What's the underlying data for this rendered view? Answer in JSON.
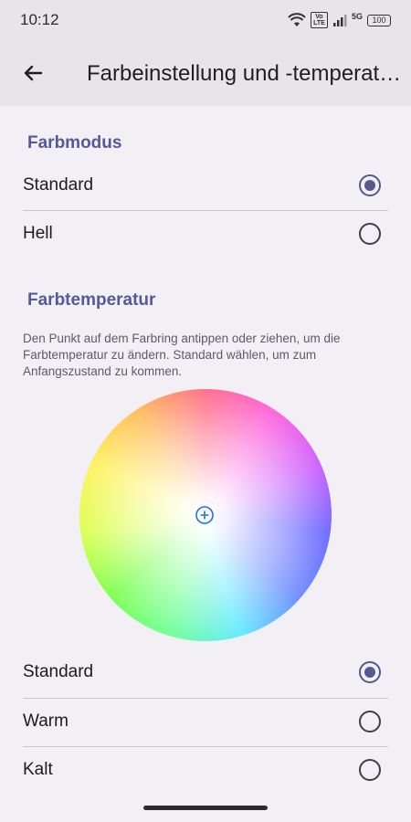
{
  "status_bar": {
    "time": "10:12",
    "volte": "Vo LTE",
    "network": "5G",
    "battery": "100"
  },
  "app_bar": {
    "title": "Farbeinstellung und -temperat…",
    "back_icon": "arrow-left-icon"
  },
  "color_mode": {
    "section_title": "Farbmodus",
    "options": [
      {
        "label": "Standard",
        "selected": true
      },
      {
        "label": "Hell",
        "selected": false
      }
    ]
  },
  "color_temperature": {
    "section_title": "Farbtemperatur",
    "description": "Den Punkt auf dem Farbring antippen oder ziehen, um die Farbtemperatur zu ändern. Standard wählen, um zum Anfangszustand zu kommen.",
    "options": [
      {
        "label": "Standard",
        "selected": true
      },
      {
        "label": "Warm",
        "selected": false
      },
      {
        "label": "Kalt",
        "selected": false
      }
    ]
  },
  "colors": {
    "accent": "#55598e",
    "section_title": "#56589a",
    "background": "#f2eff5",
    "app_bar": "#e7e4ea",
    "marker": "#1a73e8"
  }
}
